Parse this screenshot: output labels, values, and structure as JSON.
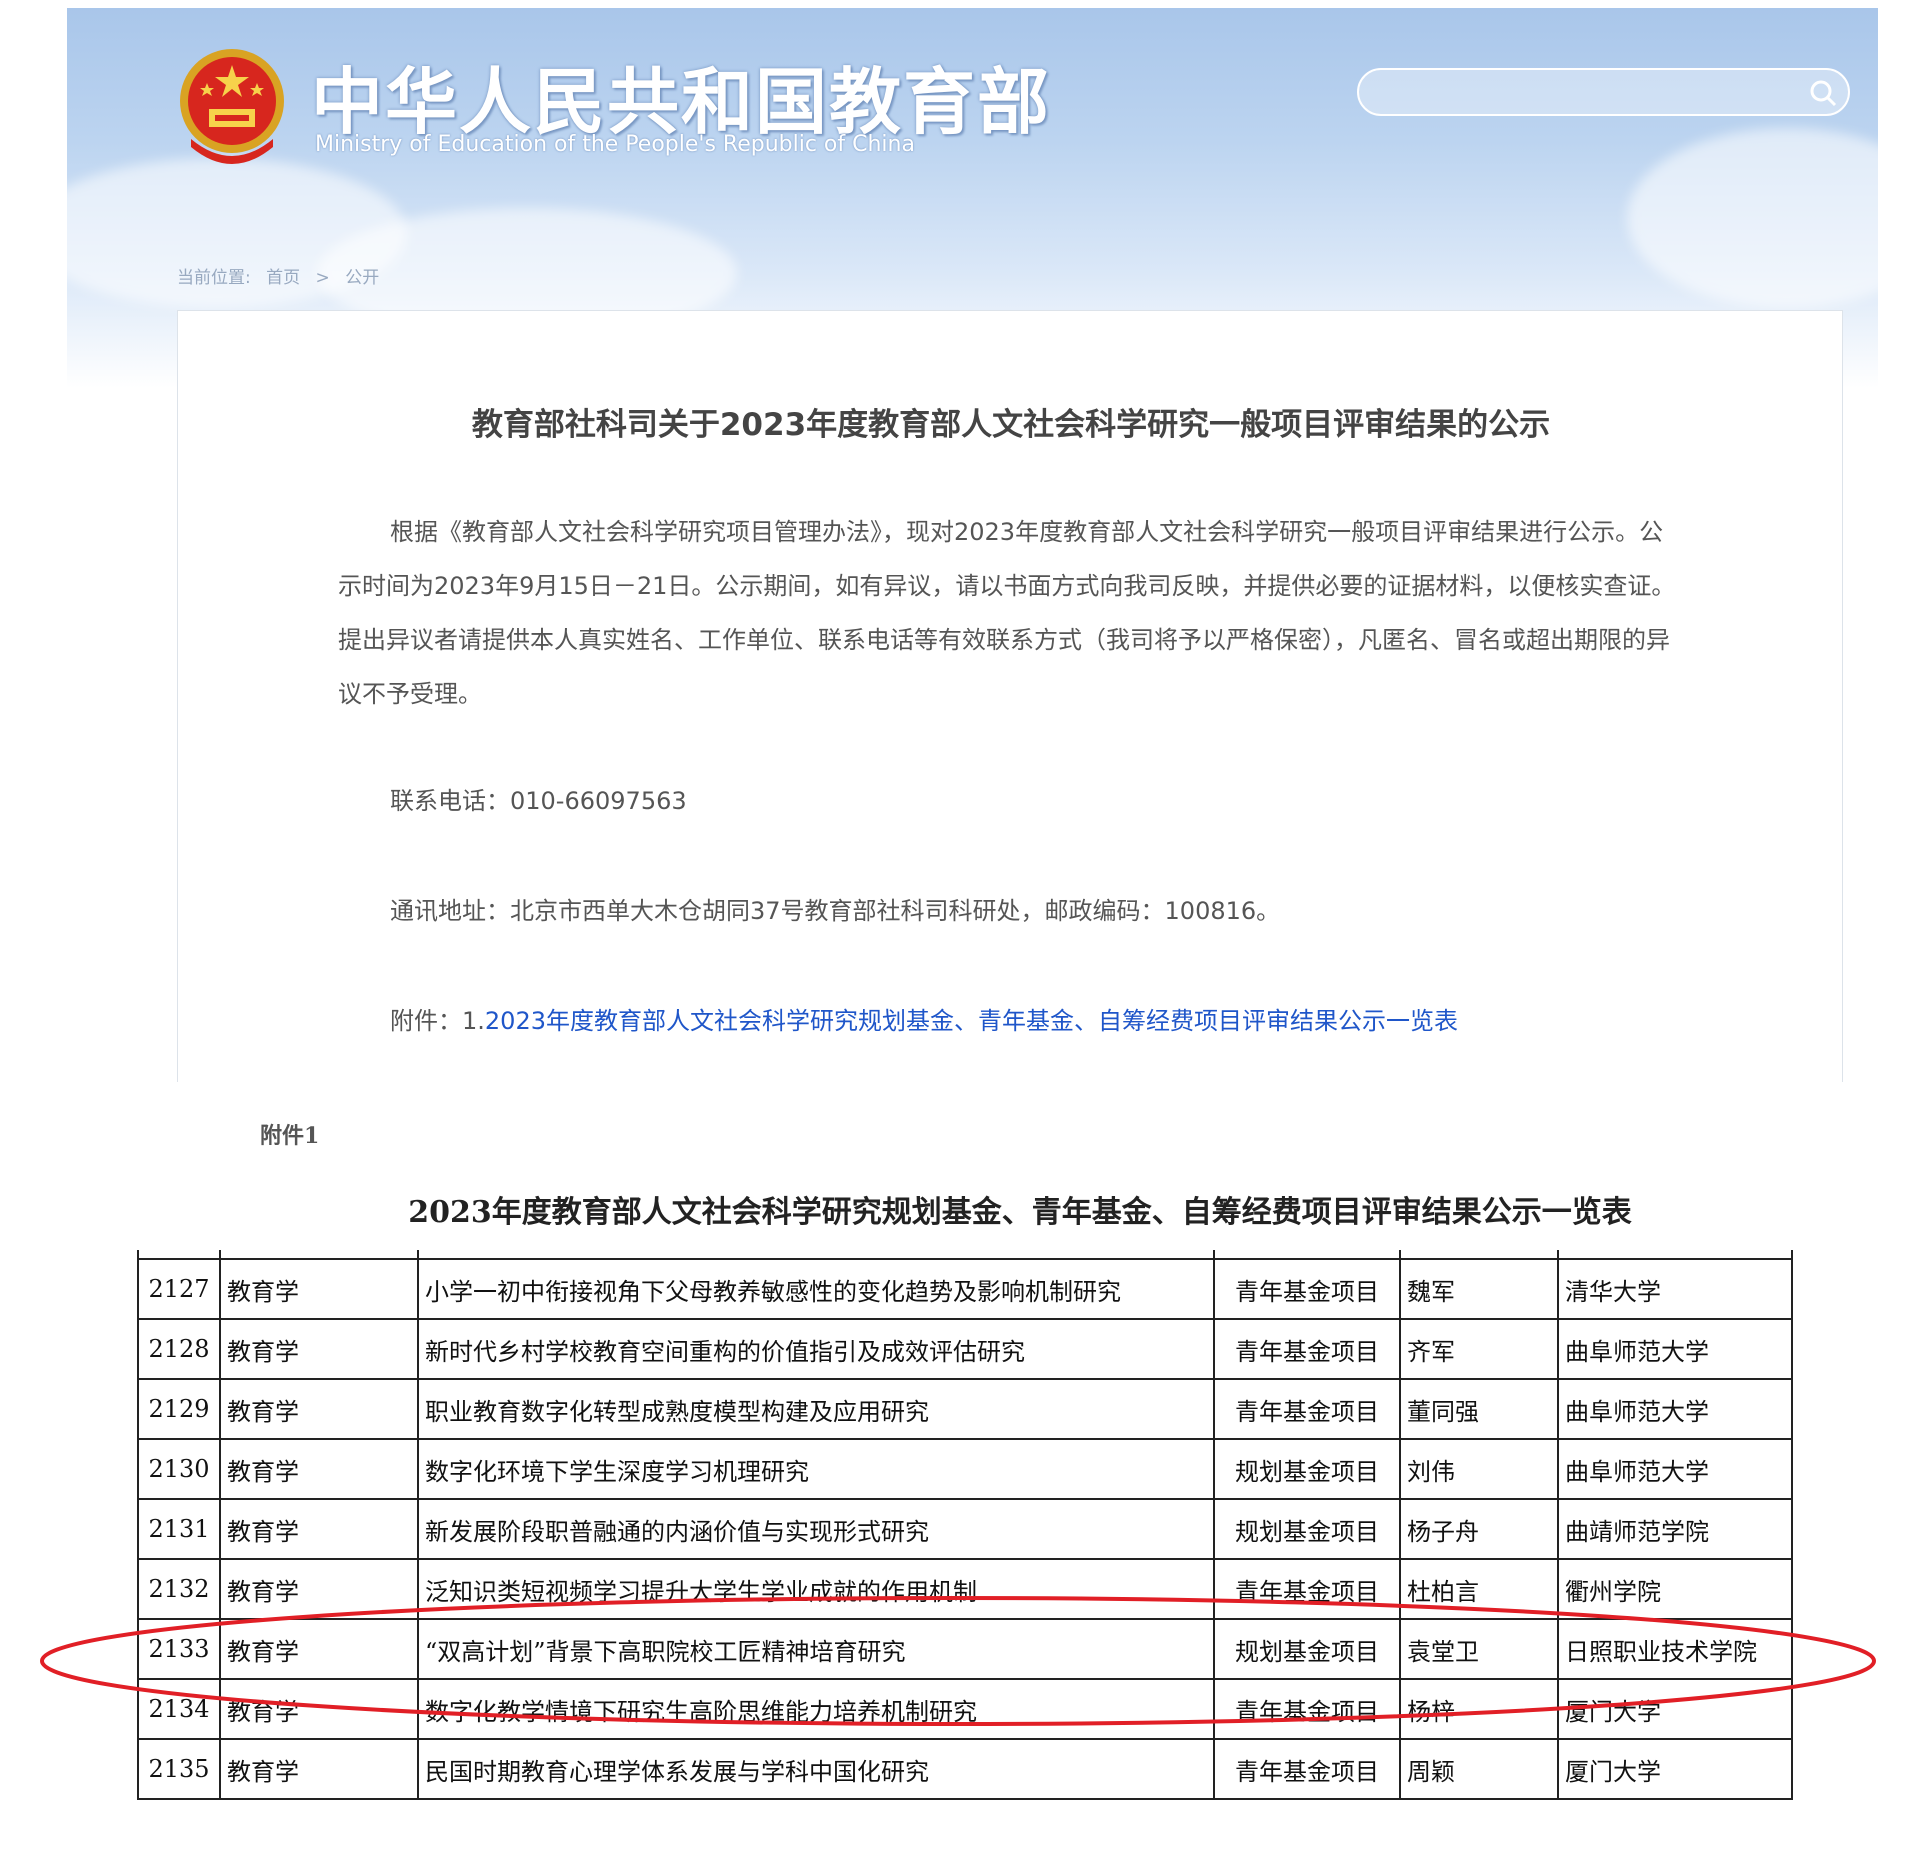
{
  "header": {
    "title": "中华人民共和国教育部",
    "subtitle": "Ministry of Education of the People's Republic of China",
    "search_placeholder": "",
    "emblem_icon": "national-emblem-icon"
  },
  "breadcrumb": {
    "label": "当前位置:",
    "home": "首页",
    "separator": ">",
    "current": "公开"
  },
  "article": {
    "title": "教育部社科司关于2023年度教育部人文社会科学研究一般项目评审结果的公示",
    "body": "根据《教育部人文社会科学研究项目管理办法》，现对2023年度教育部人文社会科学研究一般项目评审结果进行公示。公示时间为2023年9月15日－21日。公示期间，如有异议，请以书面方式向我司反映，并提供必要的证据材料，以便核实查证。提出异议者请提供本人真实姓名、工作单位、联系电话等有效联系方式（我司将予以严格保密），凡匿名、冒名或超出期限的异议不予受理。",
    "phone_label": "联系电话：",
    "phone": "010-66097563",
    "address_label": "通讯地址：",
    "address": "北京市西单大木仓胡同37号教育部社科司科研处，邮政编码：100816。",
    "attachment_label": "附件：",
    "attachment_index": "1.",
    "attachment_link": "2023年度教育部人文社会科学研究规划基金、青年基金、自筹经费项目评审结果公示一览表"
  },
  "annex": {
    "label": "附件1",
    "table_title": "2023年度教育部人文社会科学研究规划基金、青年基金、自筹经费项目评审结果公示一览表",
    "rows": [
      {
        "no": "2127",
        "discipline": "教育学",
        "title": "小学一初中衔接视角下父母教养敏感性的变化趋势及影响机制研究",
        "type": "青年基金项目",
        "person": "魏军",
        "org": "清华大学"
      },
      {
        "no": "2128",
        "discipline": "教育学",
        "title": "新时代乡村学校教育空间重构的价值指引及成效评估研究",
        "type": "青年基金项目",
        "person": "齐军",
        "org": "曲阜师范大学"
      },
      {
        "no": "2129",
        "discipline": "教育学",
        "title": "职业教育数字化转型成熟度模型构建及应用研究",
        "type": "青年基金项目",
        "person": "董同强",
        "org": "曲阜师范大学"
      },
      {
        "no": "2130",
        "discipline": "教育学",
        "title": "数字化环境下学生深度学习机理研究",
        "type": "规划基金项目",
        "person": "刘伟",
        "org": "曲阜师范大学"
      },
      {
        "no": "2131",
        "discipline": "教育学",
        "title": "新发展阶段职普融通的内涵价值与实现形式研究",
        "type": "规划基金项目",
        "person": "杨子舟",
        "org": "曲靖师范学院"
      },
      {
        "no": "2132",
        "discipline": "教育学",
        "title": "泛知识类短视频学习提升大学生学业成就的作用机制",
        "type": "青年基金项目",
        "person": "杜柏言",
        "org": "衢州学院"
      },
      {
        "no": "2133",
        "discipline": "教育学",
        "title": "“双高计划”背景下高职院校工匠精神培育研究",
        "type": "规划基金项目",
        "person": "袁堂卫",
        "org": "日照职业技术学院"
      },
      {
        "no": "2134",
        "discipline": "教育学",
        "title": "数字化教学情境下研究生高阶思维能力培养机制研究",
        "type": "青年基金项目",
        "person": "杨梓",
        "org": "厦门大学"
      },
      {
        "no": "2135",
        "discipline": "教育学",
        "title": "民国时期教育心理学体系发展与学科中国化研究",
        "type": "青年基金项目",
        "person": "周颖",
        "org": "厦门大学"
      }
    ],
    "highlight_color": "#e11f26"
  }
}
